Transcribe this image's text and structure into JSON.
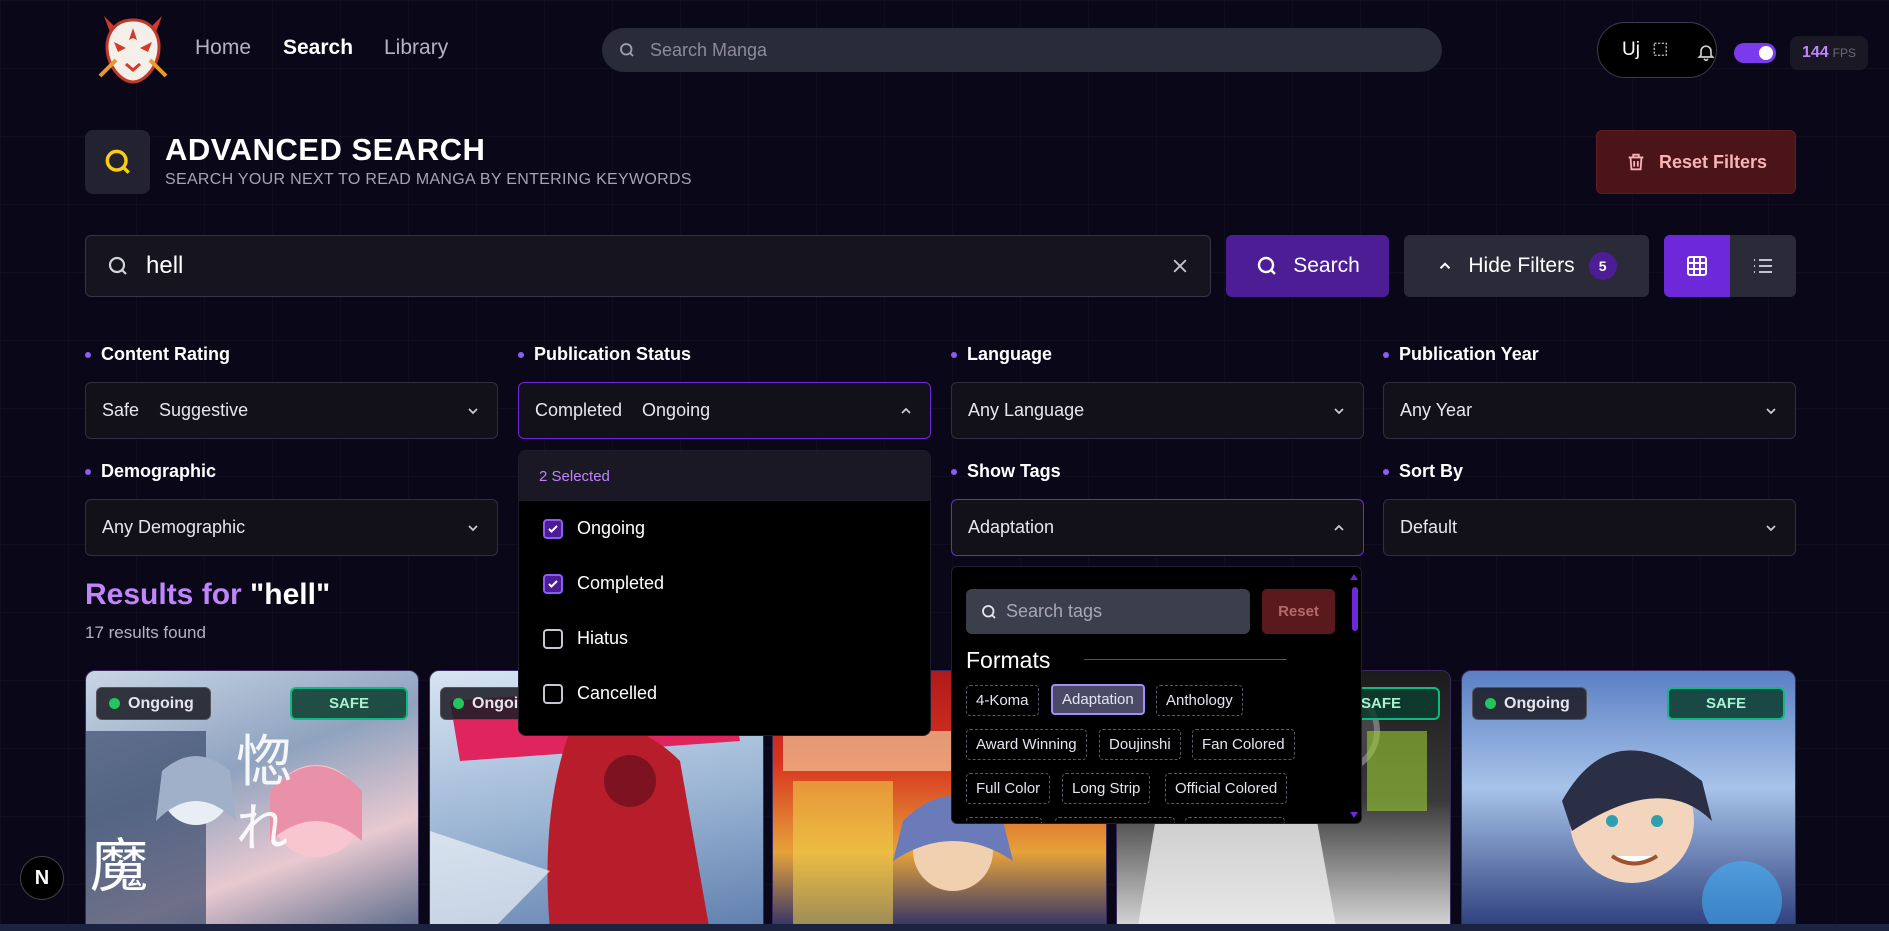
{
  "nav": {
    "links": [
      "Home",
      "Search",
      "Library"
    ],
    "active": "Search",
    "search_placeholder": "Search Manga",
    "pill_text": "Uj",
    "fps_value": "144",
    "fps_unit": "FPS"
  },
  "header": {
    "title": "ADVANCED SEARCH",
    "subtitle": "SEARCH YOUR NEXT TO READ MANGA BY ENTERING KEYWORDS",
    "reset_label": "Reset Filters"
  },
  "search": {
    "query": "hell",
    "button_label": "Search",
    "hide_filters_label": "Hide Filters",
    "active_filter_count": "5"
  },
  "filters": {
    "content_rating": {
      "label": "Content Rating",
      "values": [
        "Safe",
        "Suggestive"
      ]
    },
    "publication_status": {
      "label": "Publication Status",
      "values": [
        "Completed",
        "Ongoing"
      ]
    },
    "language": {
      "label": "Language",
      "value": "Any Language"
    },
    "publication_year": {
      "label": "Publication Year",
      "value": "Any Year"
    },
    "demographic": {
      "label": "Demographic",
      "value": "Any Demographic"
    },
    "show_tags": {
      "label": "Show Tags",
      "value": "Adaptation"
    },
    "sort_by": {
      "label": "Sort By",
      "value": "Default"
    }
  },
  "status_dropdown": {
    "header": "2 Selected",
    "options": [
      {
        "label": "Ongoing",
        "checked": true
      },
      {
        "label": "Completed",
        "checked": true
      },
      {
        "label": "Hiatus",
        "checked": false
      },
      {
        "label": "Cancelled",
        "checked": false
      }
    ]
  },
  "tags_dropdown": {
    "search_placeholder": "Search tags",
    "reset_label": "Reset",
    "section": "Formats",
    "tags": [
      "4-Koma",
      "Adaptation",
      "Anthology",
      "Award Winning",
      "Doujinshi",
      "Fan Colored",
      "Full Color",
      "Long Strip",
      "Official Colored"
    ],
    "selected": "Adaptation"
  },
  "results": {
    "prefix": "Results for",
    "query_quoted": "\"hell\"",
    "count_text": "17 results found"
  },
  "cards": [
    {
      "status": "Ongoing",
      "rating": "SAFE"
    },
    {
      "status": "Ongoing",
      "rating": ""
    },
    {
      "status": "",
      "rating": ""
    },
    {
      "status": "",
      "rating": "SAFE"
    },
    {
      "status": "Ongoing",
      "rating": "SAFE"
    }
  ],
  "colors": {
    "accent": "#6d28d9",
    "safe": "#10b981",
    "danger": "#4a1418",
    "background": "#0a0818"
  }
}
